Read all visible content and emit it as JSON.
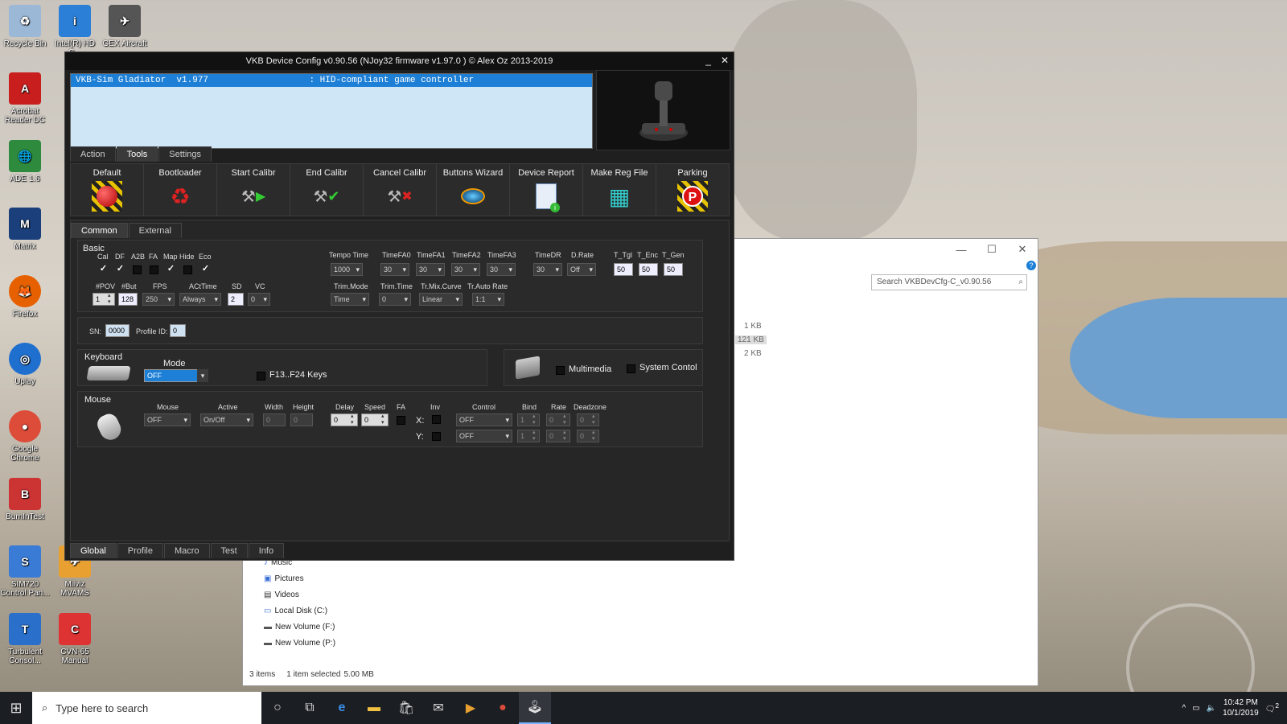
{
  "desktop": {
    "icons": [
      {
        "label": "Recycle Bin",
        "color": "#9bb8d6"
      },
      {
        "label": "Intel(R) HD G...",
        "color": "#2b7fd6"
      },
      {
        "label": "GEX Aircraft",
        "color": "#555"
      },
      {
        "label": "Acrobat Reader DC",
        "color": "#c81e1e"
      },
      {
        "label": "ADE 1.6",
        "color": "#2e8b3e"
      },
      {
        "label": "Matrix",
        "color": "#1a3f7a"
      },
      {
        "label": "Firefox",
        "color": "#e66000"
      },
      {
        "label": "Uplay",
        "color": "#1f6fcf"
      },
      {
        "label": "Google Chrome",
        "color": "#dd4b39"
      },
      {
        "label": "BurnInTest",
        "color": "#c33"
      },
      {
        "label": "SIM720 Control Pan...",
        "color": "#3a7bd5"
      },
      {
        "label": "Milviz MVAMS",
        "color": "#e8a030"
      },
      {
        "label": "Turbulent Consol...",
        "color": "#2a6fc9"
      },
      {
        "label": "CVN-65 Manual",
        "color": "#d33"
      }
    ]
  },
  "explorer": {
    "search_placeholder": "Search VKBDevCfg-C_v0.90.56",
    "sizes": [
      "1 KB",
      "121 KB",
      "2 KB"
    ],
    "nav": [
      "Music",
      "Pictures",
      "Videos",
      "Local Disk (C:)",
      "New Volume (F:)",
      "New Volume (P:)"
    ],
    "status": {
      "items": "3 items",
      "selected": "1 item selected",
      "size": "5.00 MB"
    }
  },
  "vkb": {
    "title": "VKB Device Config v0.90.56 (NJoy32 firmware v1.97.0 ) © Alex Oz 2013-2019",
    "device_line": "VKB-Sim Gladiator  v1.977                   : HID-compliant game controller",
    "top_tabs": [
      "Action",
      "Tools",
      "Settings"
    ],
    "tools": [
      "Default",
      "Bootloader",
      "Start Calibr",
      "End Calibr",
      "Cancel Calibr",
      "Buttons Wizard",
      "Device Report",
      "Make Reg File",
      "Parking"
    ],
    "sub_tabs": [
      "Common",
      "External"
    ],
    "basic": {
      "title": "Basic",
      "checks": [
        {
          "label": "Cal",
          "on": true
        },
        {
          "label": "DF",
          "on": true
        },
        {
          "label": "A2B",
          "on": false
        },
        {
          "label": "FA",
          "on": false
        },
        {
          "label": "Map",
          "on": true
        },
        {
          "label": "Hide",
          "on": false
        },
        {
          "label": "Eco",
          "on": true
        }
      ],
      "pov_label": "#POV",
      "pov": "1",
      "but_label": "#But",
      "but": "128",
      "fps_label": "FPS",
      "fps": "250",
      "actime_label": "ACtTime",
      "actime": "Always",
      "sd_label": "SD",
      "sd": "2",
      "vc_label": "VC",
      "vc": "0",
      "tempo_label": "Tempo Time",
      "tempo": "1000",
      "tfa0_label": "TimeFA0",
      "tfa0": "30",
      "tfa1_label": "TimeFA1",
      "tfa1": "30",
      "tfa2_label": "TimeFA2",
      "tfa2": "30",
      "tfa3_label": "TimeFA3",
      "tfa3": "30",
      "tdr_label": "TimeDR",
      "tdr": "30",
      "drate_label": "D.Rate",
      "drate": "Off",
      "ttgl_label": "T_Tgl",
      "ttgl": "50",
      "tenc_label": "T_Enc",
      "tenc": "50",
      "tgen_label": "T_Gen",
      "tgen": "50",
      "trmode_label": "Trim.Mode",
      "trmode": "Time",
      "trtime_label": "Trim.Time",
      "trtime": "0",
      "trmix_label": "Tr.Mix.Curve",
      "trmix": "Linear",
      "trauto_label": "Tr.Auto Rate",
      "trauto": "1:1"
    },
    "sn_label": "SN:",
    "sn": "0000",
    "profile_label": "Profile ID:",
    "profile": "0",
    "keyboard": {
      "title": "Keyboard",
      "mode_label": "Mode",
      "mode": "OFF",
      "f13_label": "F13..F24 Keys",
      "multimedia_label": "Multimedia",
      "system_label": "System Contol"
    },
    "mouse": {
      "title": "Mouse",
      "mouse_label": "Mouse",
      "mouse": "OFF",
      "active_label": "Active",
      "active": "On/Off",
      "width_label": "Width",
      "width": "0",
      "height_label": "Height",
      "height": "0",
      "delay_label": "Delay",
      "delay": "0",
      "speed_label": "Speed",
      "speed": "0",
      "fa_label": "FA",
      "inv_label": "Inv",
      "x_label": "X:",
      "y_label": "Y:",
      "control_label": "Control",
      "control_x": "OFF",
      "control_y": "OFF",
      "bind_label": "Bind",
      "bind_x": "1",
      "bind_y": "1",
      "rate_label": "Rate",
      "rate_x": "0",
      "rate_y": "0",
      "dz_label": "Deadzone",
      "dz_x": "0",
      "dz_y": "0"
    },
    "bottom_tabs": [
      "Global",
      "Profile",
      "Macro",
      "Test",
      "Info"
    ]
  },
  "taskbar": {
    "search_placeholder": "Type here to search",
    "time": "10:42 PM",
    "date": "10/1/2019",
    "notif_count": "2"
  }
}
